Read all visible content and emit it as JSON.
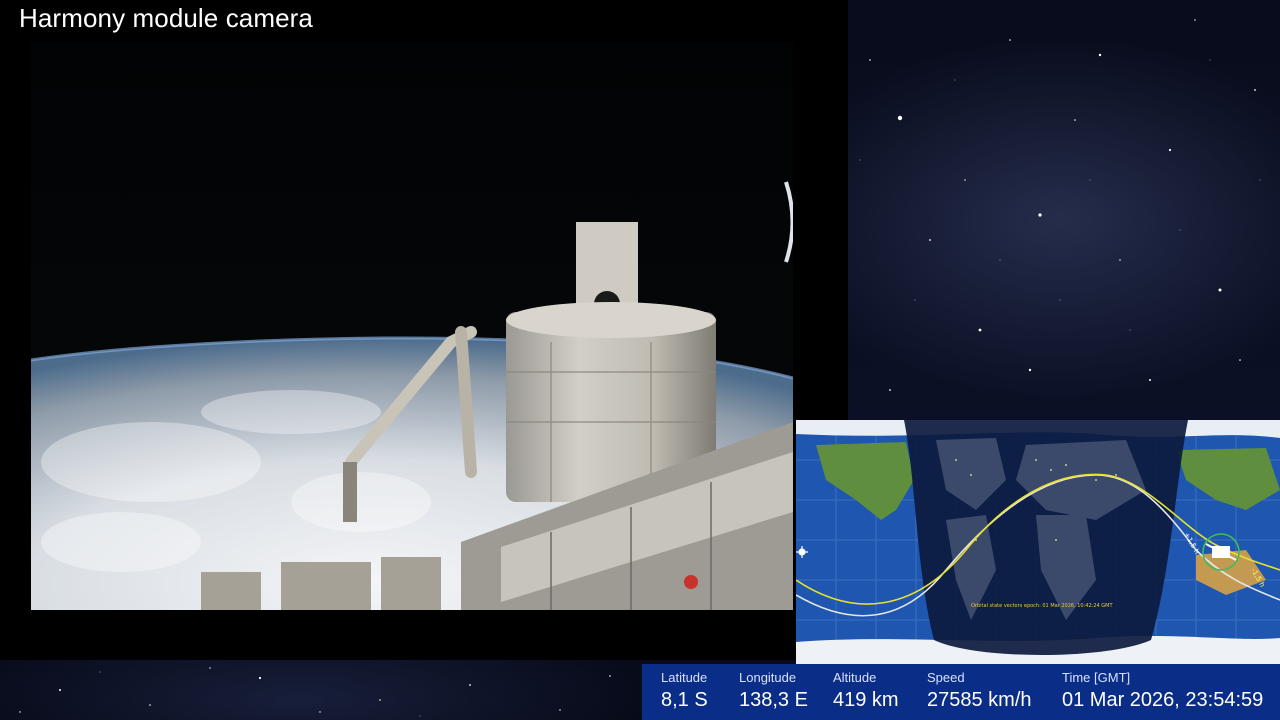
{
  "title": "Harmony module camera",
  "map": {
    "epoch_text": "Orbital state vectors epoch: 01 Mar 2026, 10:42:24 GMT",
    "plus_label": "+1,5 h",
    "minus_label": "-1,5 h",
    "track_colors": {
      "future": "#e6e6e6",
      "past": "#e8e030"
    }
  },
  "telemetry": {
    "latitude": {
      "label": "Latitude",
      "value": "8,1 S"
    },
    "longitude": {
      "label": "Longitude",
      "value": "138,3 E"
    },
    "altitude": {
      "label": "Altitude",
      "value": "419 km"
    },
    "speed": {
      "label": "Speed",
      "value": "27585 km/h"
    },
    "time": {
      "label": "Time [GMT]",
      "value": "01 Mar 2026, 23:54:59"
    }
  },
  "icons": [
    "iss-icon",
    "sun-icon"
  ]
}
